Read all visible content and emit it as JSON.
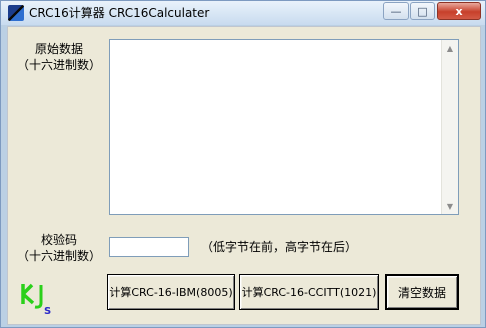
{
  "window": {
    "title": "CRC16计算器 CRC16Calculater",
    "controls": [
      "—",
      "□",
      "x"
    ]
  },
  "fields": {
    "raw_data_label": [
      "原始数据",
      "（十六进制数）"
    ],
    "raw_data_value": "",
    "checksum_label": [
      "校验码",
      "（十六进制数）"
    ],
    "checksum_value": "",
    "byte_order_note": "（低字节在前，高字节在后）"
  },
  "buttons": {
    "ibm": "计算CRC-16-IBM(8005)",
    "ccitt": "计算CRC-16-CCITT(1021)",
    "clear": "清空数据"
  },
  "colors": {
    "logo": "#2bd01a",
    "accent": "#1b3d8c"
  },
  "icons": {
    "app": "crc-app-icon",
    "logo": "kjs-logo"
  }
}
